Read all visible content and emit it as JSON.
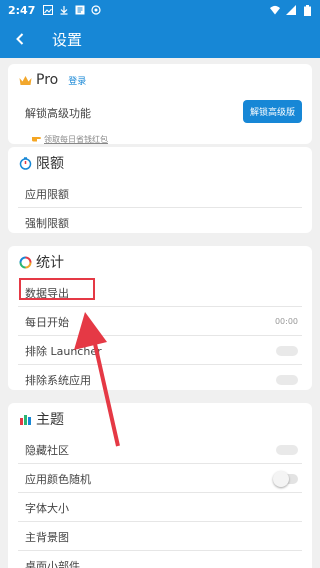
{
  "status_bar": {
    "time": "2:47",
    "left_icons": [
      "image-icon",
      "download-icon",
      "text-icon",
      "at-icon"
    ],
    "right_icons": [
      "wifi-icon",
      "signal-icon",
      "battery-icon"
    ]
  },
  "app_bar": {
    "title": "设置",
    "back_icon": "back-arrow-icon"
  },
  "pro_section": {
    "title": "Pro",
    "login": "登录",
    "unlock_label": "解锁高级功能",
    "unlock_button": "解锁高级版",
    "coupon_text": "领取每日省钱红包"
  },
  "limit_section": {
    "title": "限额",
    "items": [
      "应用限额",
      "强制限额"
    ]
  },
  "stats_section": {
    "title": "统计",
    "items": [
      {
        "label": "数据导出"
      },
      {
        "label": "每日开始",
        "value": "00:00"
      },
      {
        "label": "排除 Launcher",
        "toggle": false
      },
      {
        "label": "排除系统应用",
        "toggle": false
      }
    ]
  },
  "theme_section": {
    "title": "主题",
    "items": [
      {
        "label": "隐藏社区",
        "toggle": false
      },
      {
        "label": "应用颜色随机",
        "toggle": false
      },
      {
        "label": "字体大小"
      },
      {
        "label": "主背景图"
      },
      {
        "label": "桌面小部件"
      }
    ]
  },
  "colors": {
    "primary": "#1787d6",
    "highlight": "#e53945",
    "background": "#f0f0f0"
  }
}
